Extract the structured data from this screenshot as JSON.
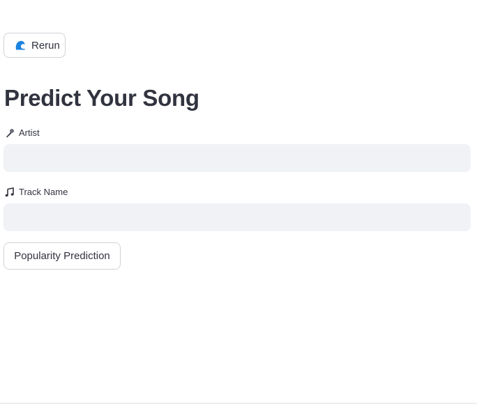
{
  "toolbar": {
    "rerun_label": "Rerun",
    "rerun_icon": "rerun-wave-icon"
  },
  "main": {
    "title": "Predict Your Song",
    "fields": [
      {
        "label": "Artist",
        "icon": "microphone-icon",
        "value": "",
        "placeholder": ""
      },
      {
        "label": "Track Name",
        "icon": "music-notes-icon",
        "value": "",
        "placeholder": ""
      }
    ],
    "predict_button_label": "Popularity Prediction"
  },
  "colors": {
    "accent": "#1c83e1",
    "text": "#31333f",
    "input_background": "#f0f2f6",
    "border": "#d0d2d8"
  }
}
